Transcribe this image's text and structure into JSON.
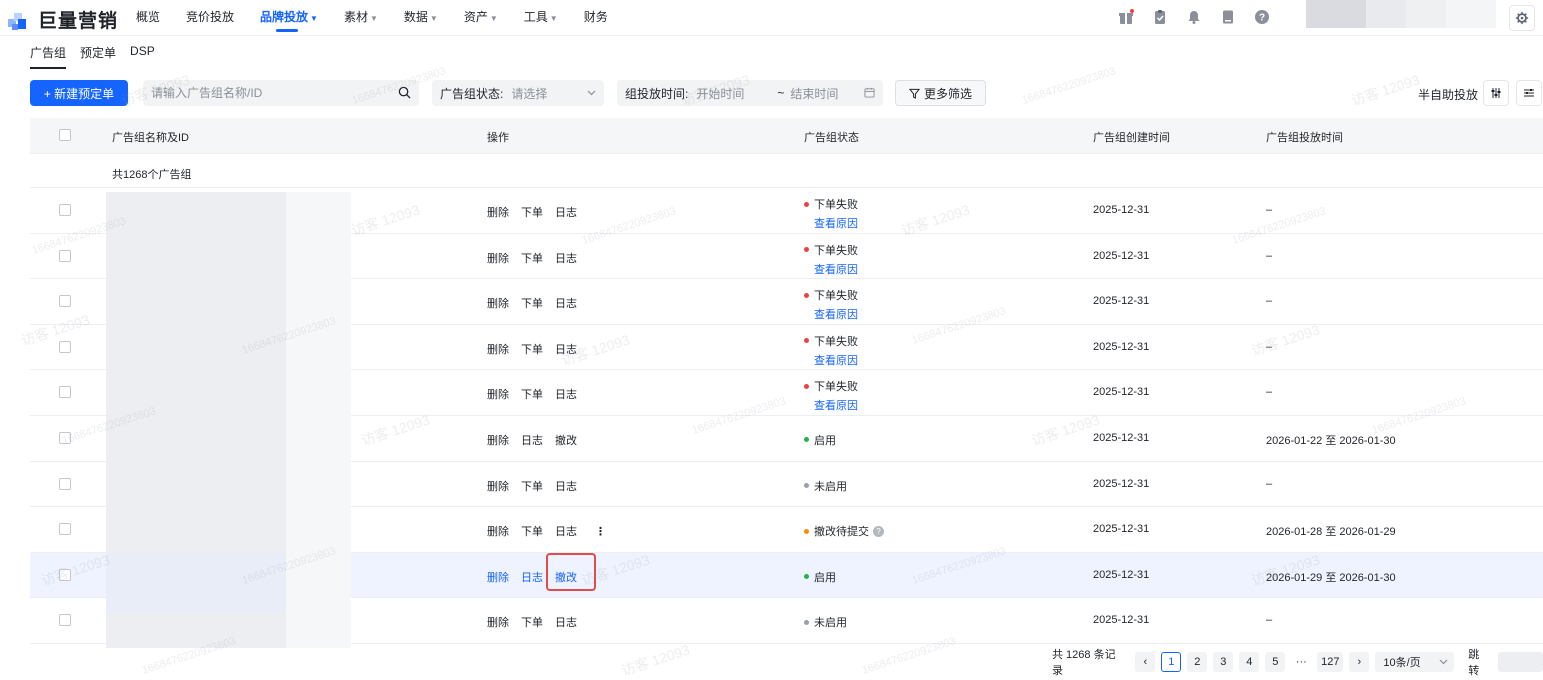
{
  "logo": {
    "text": "巨量营销"
  },
  "nav": [
    {
      "label": "概览",
      "caret": ""
    },
    {
      "label": "竞价投放",
      "caret": ""
    },
    {
      "label": "品牌投放",
      "caret": "▼"
    },
    {
      "label": "素材",
      "caret": "▼"
    },
    {
      "label": "数据",
      "caret": "▼"
    },
    {
      "label": "资产",
      "caret": "▼"
    },
    {
      "label": "工具",
      "caret": "▼"
    },
    {
      "label": "财务",
      "caret": ""
    }
  ],
  "subtabs": [
    "广告组",
    "预定单",
    "DSP"
  ],
  "toolbar": {
    "new_button": "+ 新建预定单",
    "search_placeholder": "请输入广告组名称/ID",
    "status_label": "广告组状态:",
    "status_placeholder": "请选择",
    "time_label": "组投放时间:",
    "start_placeholder": "开始时间",
    "tilde": "~",
    "end_placeholder": "结束时间",
    "more_filter": "更多筛选",
    "semi_auto": "半自助投放"
  },
  "table": {
    "headers": {
      "name": "广告组名称及ID",
      "ops": "操作",
      "status": "广告组状态",
      "created": "广告组创建时间",
      "delivery": "广告组投放时间"
    },
    "summary": "共1268个广告组",
    "rows": [
      {
        "ops": [
          "删除",
          "下单",
          "日志"
        ],
        "status": "下单失败",
        "status_color": "#f04142",
        "reason": "查看原因",
        "created": "2025-12-31",
        "delivery": "–"
      },
      {
        "ops": [
          "删除",
          "下单",
          "日志"
        ],
        "status": "下单失败",
        "status_color": "#f04142",
        "reason": "查看原因",
        "created": "2025-12-31",
        "delivery": "–"
      },
      {
        "ops": [
          "删除",
          "下单",
          "日志"
        ],
        "status": "下单失败",
        "status_color": "#f04142",
        "reason": "查看原因",
        "created": "2025-12-31",
        "delivery": "–"
      },
      {
        "ops": [
          "删除",
          "下单",
          "日志"
        ],
        "status": "下单失败",
        "status_color": "#f04142",
        "reason": "查看原因",
        "created": "2025-12-31",
        "delivery": "–"
      },
      {
        "ops": [
          "删除",
          "下单",
          "日志"
        ],
        "status": "下单失败",
        "status_color": "#f04142",
        "reason": "查看原因",
        "created": "2025-12-31",
        "delivery": "–"
      },
      {
        "ops": [
          "删除",
          "日志",
          "撤改"
        ],
        "status": "启用",
        "status_color": "#22b34a",
        "reason": "",
        "created": "2025-12-31",
        "delivery": "2026-01-22 至 2026-01-30"
      },
      {
        "ops": [
          "删除",
          "下单",
          "日志"
        ],
        "status": "未启用",
        "status_color": "#9aa0a8",
        "reason": "",
        "created": "2025-12-31",
        "delivery": "–"
      },
      {
        "ops": [
          "删除",
          "下单",
          "日志"
        ],
        "status": "撤改待提交",
        "status_color": "#ff8a00",
        "reason": "",
        "created": "2025-12-31",
        "delivery": "2026-01-28 至 2026-01-29",
        "more": "⋮",
        "hint": "?"
      },
      {
        "ops": [
          "删除",
          "日志",
          "撤改"
        ],
        "status": "启用",
        "status_color": "#22b34a",
        "reason": "",
        "created": "2025-12-31",
        "delivery": "2026-01-29 至 2026-01-30"
      },
      {
        "ops": [
          "删除",
          "下单",
          "日志"
        ],
        "status": "未启用",
        "status_color": "#9aa0a8",
        "reason": "",
        "created": "2025-12-31",
        "delivery": "–"
      }
    ]
  },
  "pagination": {
    "total": "共 1268 条记录",
    "prev": "‹",
    "pages": [
      "1",
      "2",
      "3",
      "4",
      "5"
    ],
    "ellipsis": "···",
    "last": "127",
    "next": "›",
    "page_size": "10条/页",
    "jump_label": "跳转"
  },
  "watermark": {
    "text1": "访客 12093",
    "text2": "1668476220923803"
  },
  "colors": {
    "primary": "#1664ff",
    "danger": "#f04142",
    "success": "#22b34a",
    "warning": "#ff8a00",
    "highlight_row": "#eef3ff",
    "annotation": "#e04b4b"
  }
}
